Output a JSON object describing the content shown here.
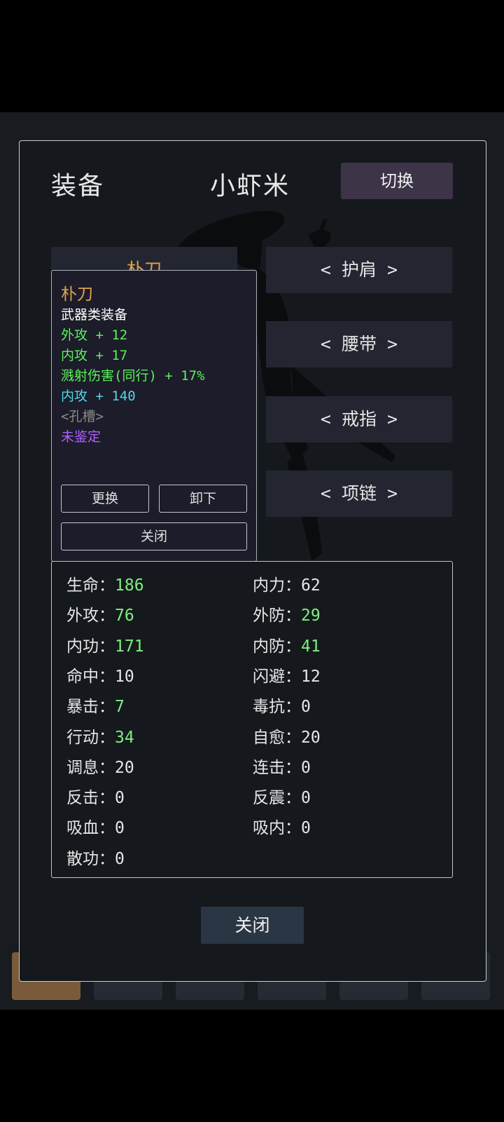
{
  "header": {
    "section_title": "装备",
    "character_name": "小虾米",
    "switch_label": "切换"
  },
  "slots_left": [
    {
      "label": "朴刀"
    }
  ],
  "slots_right": [
    {
      "label": "< 护肩 >"
    },
    {
      "label": "< 腰带 >"
    },
    {
      "label": "< 戒指 >"
    },
    {
      "label": "< 项链 >"
    }
  ],
  "tooltip": {
    "item_name": "朴刀",
    "category": "武器类装备",
    "attrs": [
      {
        "text": "外攻 + 12",
        "color": "#5cf25c"
      },
      {
        "text": "内攻 + 17",
        "color": "#5cf25c"
      },
      {
        "text": "溅射伤害(同行) + 17%",
        "color": "#5cf25c"
      },
      {
        "text": "内攻 + 140",
        "color": "#4fd8e8"
      },
      {
        "text": "<孔槽>",
        "color": "#8a8a8a"
      },
      {
        "text": "未鉴定",
        "color": "#b060ff"
      }
    ],
    "replace_label": "更换",
    "unequip_label": "卸下",
    "close_label": "关闭"
  },
  "stats": {
    "left": [
      {
        "label": "生命：",
        "value": "186",
        "color": "green"
      },
      {
        "label": "外攻：",
        "value": "76",
        "color": "green"
      },
      {
        "label": "内功：",
        "value": "171",
        "color": "green"
      },
      {
        "label": "命中：",
        "value": "10",
        "color": "white"
      },
      {
        "label": "暴击：",
        "value": "7",
        "color": "green"
      },
      {
        "label": "行动：",
        "value": "34",
        "color": "green"
      },
      {
        "label": "调息：",
        "value": "20",
        "color": "white"
      },
      {
        "label": "反击：",
        "value": "0",
        "color": "white"
      },
      {
        "label": "吸血：",
        "value": "0",
        "color": "white"
      },
      {
        "label": "散功：",
        "value": "0",
        "color": "white"
      }
    ],
    "right": [
      {
        "label": "内力：",
        "value": "62",
        "color": "white"
      },
      {
        "label": "外防：",
        "value": "29",
        "color": "green"
      },
      {
        "label": "内防：",
        "value": "41",
        "color": "green"
      },
      {
        "label": "闪避：",
        "value": "12",
        "color": "white"
      },
      {
        "label": "毒抗：",
        "value": "0",
        "color": "white"
      },
      {
        "label": "自愈：",
        "value": "20",
        "color": "white"
      },
      {
        "label": "连击：",
        "value": "0",
        "color": "white"
      },
      {
        "label": "反震：",
        "value": "0",
        "color": "white"
      },
      {
        "label": "吸内：",
        "value": "0",
        "color": "white"
      }
    ]
  },
  "footer": {
    "close_label": "关闭"
  },
  "colors": {
    "accent_gold": "#e0a24a",
    "switch_bg": "#3d3448",
    "stat_green": "#7ef07e"
  }
}
